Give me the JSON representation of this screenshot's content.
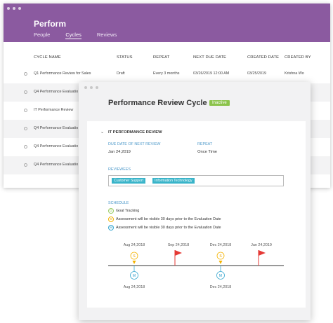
{
  "app": {
    "title": "Perform"
  },
  "nav": {
    "people": "People",
    "cycles": "Cycles",
    "reviews": "Reviews"
  },
  "table": {
    "headers": {
      "name": "CYCLE NAME",
      "status": "STATUS",
      "repeat": "REPEAT",
      "next_due": "NEXT DUE DATE",
      "created": "CREATED DATE",
      "created_by": "CREATED BY"
    },
    "rows": [
      {
        "name": "Q1 Performance  Review for Sales",
        "status": "Draft",
        "repeat": "Every 3 months",
        "next_due": "03/26/2019 12:00 AM",
        "created": "03/25/2019",
        "created_by": "Krishna Wo"
      },
      {
        "name": "Q4 Performance Evaluatio"
      },
      {
        "name": "IT Performance Review"
      },
      {
        "name": "Q4 Performance Evaluatio"
      },
      {
        "name": "Q4 Performance Evaluatio"
      },
      {
        "name": "Q4 Performance Evaluatio"
      }
    ]
  },
  "panel": {
    "title": "Performance Review Cycle",
    "status_badge": "Inactive",
    "section_title": "IT PERFORMANCE REVIEW",
    "due_label": "DUE DATE OF NEXT REVIEW",
    "due_value": "Jan 24,2019",
    "repeat_label": "REPEAT",
    "repeat_value": "Once Time",
    "reviewees_label": "REVIEWEES",
    "reviewees": [
      "Customer Support",
      "Information Technology"
    ],
    "schedule_label": "SCHEDULE",
    "schedule": [
      {
        "letter": "G",
        "text": "Goal Tracking",
        "color": "#8bc34a"
      },
      {
        "letter": "S",
        "text": "Assessment will be visible 30 days prior to the Evaluation Date",
        "color": "#f5b400"
      },
      {
        "letter": "M",
        "text": "Assessment will be visible 30 days prior to the Evaluation Date",
        "color": "#2b9ac9"
      }
    ],
    "timeline": {
      "top_dates": [
        "Aug 24,2018",
        "Sep 24,2018",
        "Dec 24,2018",
        "Jan 24,2019"
      ],
      "bottom_dates": [
        "Aug 24,2018",
        "Dec 24,2018"
      ]
    }
  },
  "colors": {
    "header": "#8b5aa0",
    "accent": "#39b4c9",
    "badge": "#8bc34a",
    "flag": "#e53935"
  }
}
